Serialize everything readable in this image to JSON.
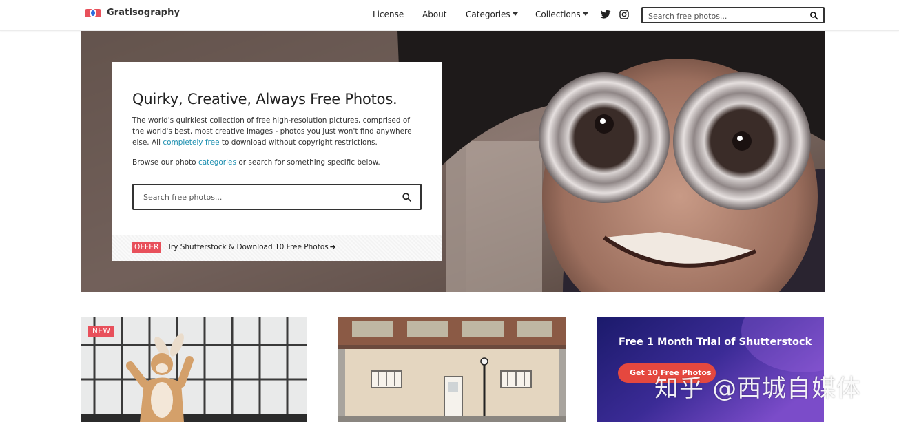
{
  "brand": {
    "name": "Gratisography",
    "logo_icon": "gratisography-logo-icon"
  },
  "nav": {
    "items": [
      {
        "label": "License",
        "has_dropdown": false
      },
      {
        "label": "About",
        "has_dropdown": false
      },
      {
        "label": "Categories",
        "has_dropdown": true
      },
      {
        "label": "Collections",
        "has_dropdown": true
      }
    ],
    "social": [
      "twitter-icon",
      "instagram-icon"
    ],
    "search_placeholder": "Search free photos..."
  },
  "hero": {
    "title": "Quirky, Creative, Always Free Photos.",
    "description_part1": "The world's quirkiest collection of free high-resolution pictures, comprised of the world's best, most creative images - photos you just won't find anywhere else. All ",
    "description_link": "completely free",
    "description_part2": " to download without copyright restrictions.",
    "browse_part1": "Browse our photo ",
    "browse_link": "categories",
    "browse_part2": " or search for something specific below.",
    "search_placeholder": "Search free photos...",
    "offer_badge": "OFFER",
    "offer_text": "Try Shutterstock & Download 10 Free Photos"
  },
  "cards": [
    {
      "badge": "NEW",
      "image": "person-in-bunny-costume"
    },
    {
      "image": "storefront-building"
    },
    {
      "promo_title": "Free 1 Month Trial of Shutterstock",
      "promo_button": "Get 10 Free Photos"
    }
  ],
  "watermark": "知乎 @西城自媒体",
  "colors": {
    "accent_red": "#e8505b",
    "link_blue": "#1e8fb0",
    "promo_gradient_start": "#1b1a6b",
    "promo_gradient_end": "#7b4cc9"
  }
}
